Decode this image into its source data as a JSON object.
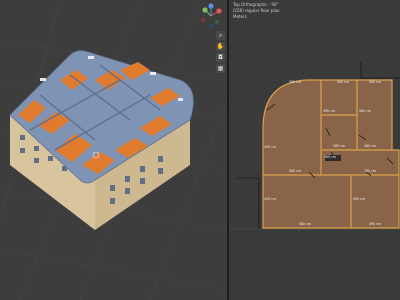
{
  "left_viewport": {
    "gizmo_axes": {
      "x": "X",
      "y": "Y",
      "z": "Z"
    },
    "nav_buttons": [
      {
        "icon": "zoom-icon",
        "glyph": "⌕"
      },
      {
        "icon": "hand-pan-icon",
        "glyph": "✋"
      },
      {
        "icon": "camera-icon",
        "glyph": "◘"
      },
      {
        "icon": "grid-perspective-icon",
        "glyph": "▦"
      }
    ]
  },
  "right_viewport": {
    "overlay": {
      "view": "Top Orthographic - 90°",
      "object": "(256) regular floor plan",
      "units": "Meters"
    },
    "dimensions": [
      "580 cm",
      "580 cm",
      "580 cm",
      "490 cm",
      "490 cm",
      "580 cm",
      "580 cm",
      "580 cm",
      "560 cm",
      "480 cm",
      "580 cm",
      "490 cm",
      "490 cm",
      "580 cm",
      "490 cm"
    ]
  },
  "colors": {
    "floor": "#8a6449",
    "wall": "#d9a24a",
    "building_wall": "#7f94b4",
    "building_side": "#d9c59d",
    "orange_floor": "#e07a2d"
  }
}
